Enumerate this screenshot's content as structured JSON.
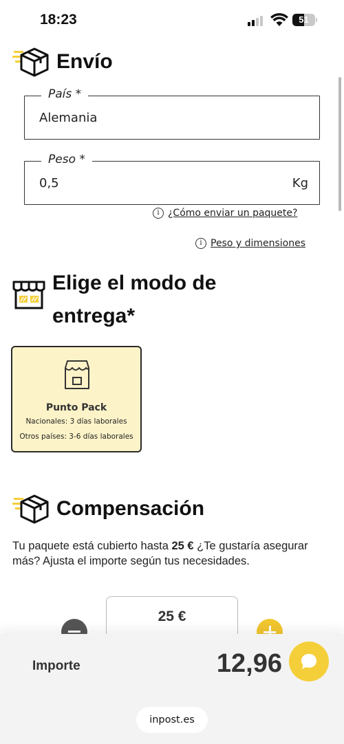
{
  "status_bar": {
    "time": "18:23",
    "battery": "51",
    "battery_level": 0.51,
    "icons": [
      "signal-icon",
      "wifi-icon",
      "battery-icon"
    ]
  },
  "shipping": {
    "title": "Envío",
    "icon": "package-box-icon",
    "country_field": {
      "label": "País *",
      "value": "Alemania"
    },
    "weight_field": {
      "label": "Peso *",
      "value": "0,5",
      "unit": "Kg"
    },
    "help_links": [
      {
        "icon": "info-icon",
        "label": "¿Cómo enviar un paquete?"
      },
      {
        "icon": "info-icon",
        "label": "Peso y dimensiones"
      }
    ]
  },
  "delivery": {
    "title_line1": "Elige el modo de",
    "title_line2": "entrega*",
    "icon": "storefront-icon",
    "options": [
      {
        "title": "Punto Pack",
        "national": "Nacionales: 3 días laborales",
        "other": "Otros países: 3-6 días laborales",
        "selected": true,
        "icon": "pickup-point-icon"
      }
    ]
  },
  "compensation": {
    "title": "Compensación",
    "icon": "package-box-icon",
    "text_before": "Tu paquete está cubierto hasta ",
    "amount_bold": "25 €",
    "text_after": " ¿Te gustaría asegurar más? Ajusta el importe según tus necesidades.",
    "stepper_value": "25 €"
  },
  "footer": {
    "total_label": "Importe",
    "total_value": "12,96",
    "chat_icon": "chat-bubble-icon",
    "url": "inpost.es"
  },
  "colors": {
    "accent_yellow": "#f5cf3a",
    "card_bg": "#fdf3c8",
    "text_dark": "#111111"
  }
}
